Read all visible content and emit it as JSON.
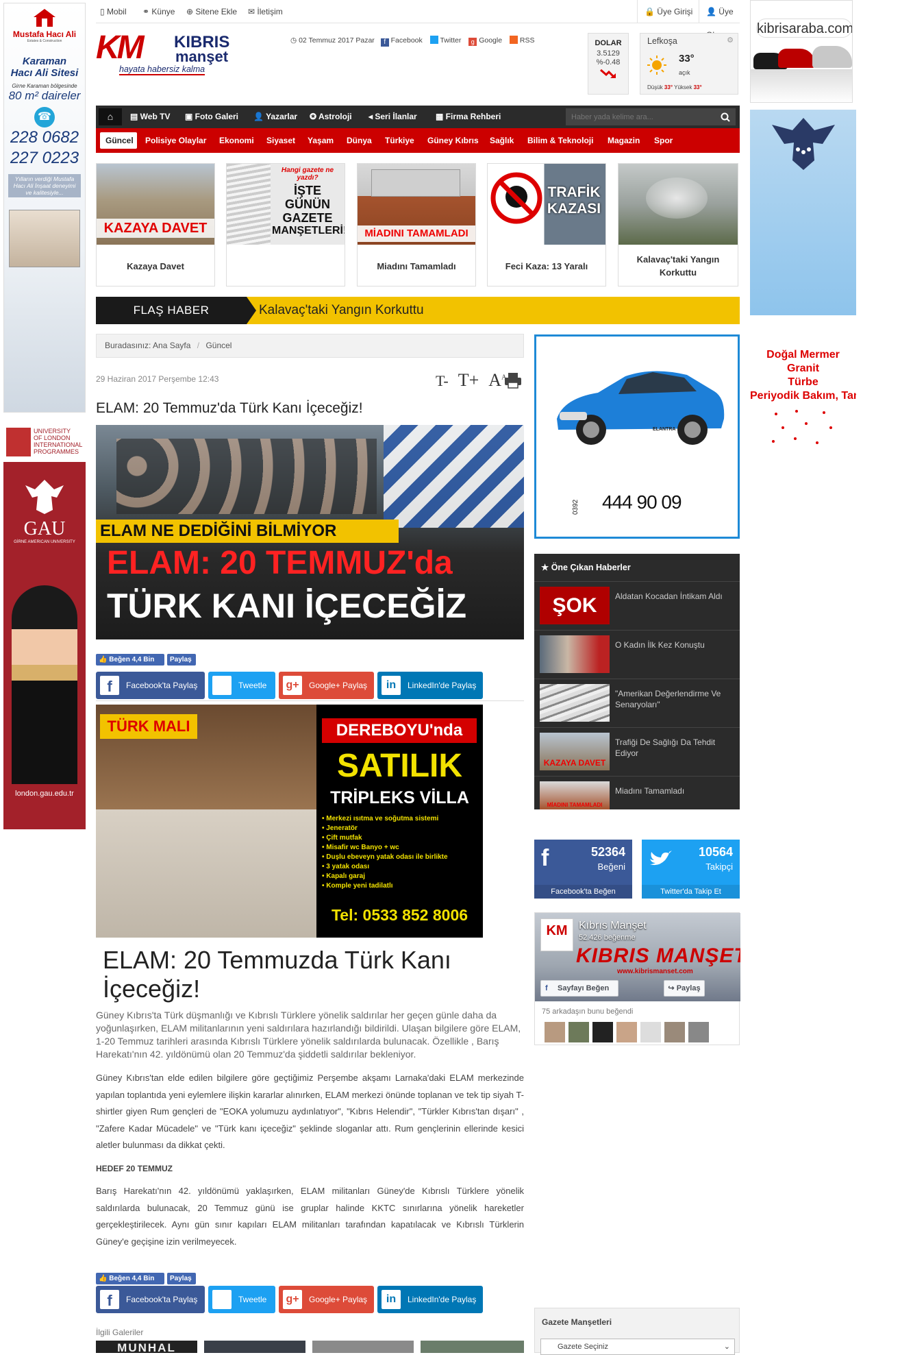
{
  "topbar": {
    "mobil": "Mobil",
    "kunye": "Künye",
    "sitene_ekle": "Sitene Ekle",
    "iletisim": "İletişim",
    "uye_girisi": "Üye Girişi",
    "uye_ol": "Üye Ol"
  },
  "logo": {
    "km": "KM",
    "kibris": "KIBRIS",
    "manset": "manşet",
    "tagline": "hayata habersiz kalma"
  },
  "header": {
    "date": "02 Temmuz 2017 Pazar",
    "facebook": "Facebook",
    "twitter": "Twitter",
    "google": "Google",
    "rss": "RSS"
  },
  "currency": {
    "label": "DOLAR",
    "value": "3.5129",
    "change": "%-0.48"
  },
  "weather": {
    "city": "Lefkoşa",
    "temp": "33°",
    "desc": "açık",
    "low_label": "Düşük",
    "low": "33°",
    "high_label": "Yüksek",
    "high": "33°"
  },
  "nav": {
    "items": [
      "Web TV",
      "Foto Galeri",
      "Yazarlar",
      "Astroloji",
      "Seri İlanlar",
      "Firma Rehberi"
    ],
    "search_placeholder": "Haber yada kelime ara..."
  },
  "categories": [
    "Güncel",
    "Polisiye Olaylar",
    "Ekonomi",
    "Siyaset",
    "Yaşam",
    "Dünya",
    "Türkiye",
    "Güney Kıbrıs",
    "Sağlık",
    "Bilim & Teknoloji",
    "Magazin",
    "Spor"
  ],
  "cards": [
    {
      "overlay": "KAZAYA DAVET",
      "caption": "Kazaya Davet"
    },
    {
      "overlay_line1": "Hangi gazete ne yazdı?",
      "overlay_line2": "İŞTE GÜNÜN",
      "overlay_line3": "GAZETE",
      "overlay_line4": "MANŞETLERİ!",
      "caption": ""
    },
    {
      "overlay": "MİADINI TAMAMLADI",
      "caption": "Miadını Tamamladı"
    },
    {
      "overlay": "TRAFİK KAZASI",
      "caption": "Feci Kaza: 13 Yaralı"
    },
    {
      "caption": "Kalavaç'taki Yangın Korkuttu"
    }
  ],
  "flash": {
    "label": "FLAŞ HABER",
    "headline": "Kalavaç'taki Yangın Korkuttu"
  },
  "breadcrumb": {
    "prefix": "Buradasınız:",
    "home": "Ana Sayfa",
    "current": "Güncel"
  },
  "article": {
    "date": "29 Haziran 2017 Perşembe 12:43",
    "title": "ELAM: 20 Temmuz'da Türk Kanı İçeceğiz!",
    "image_banner1": "ELAM NE DEDİĞİNİ BİLMİYOR",
    "image_banner2": "ELAM: 20 TEMMUZ'da",
    "image_banner3": "TÜRK KANI İÇECEĞİZ",
    "like_label": "Beğen",
    "like_count": "4,4 Bin",
    "share_label": "Paylaş",
    "fb_share": "Facebook'ta Paylaş",
    "tw_share": "Tweetle",
    "gp_share": "Google+ Paylaş",
    "li_share": "LinkedIn'de Paylaş",
    "heading": "ELAM: 20 Temmuzda Türk Kanı İçeceğiz!",
    "lead": "Güney Kıbrıs'ta Türk düşmanlığı ve Kıbrıslı Türklere yönelik saldırılar her geçen günle daha da yoğunlaşırken, ELAM militanlarının yeni saldırılara hazırlandığı bildirildi. Ulaşan bilgilere göre ELAM, 1-20 Temmuz tarihleri arasında Kıbrıslı Türklere yönelik saldırılarda bulunacak. Özellikle , Barış Harekatı'nın 42. yıldönümü olan 20 Temmuz'da şiddetli saldırılar bekleniyor.",
    "p1": "Güney Kıbrıs'tan elde edilen bilgilere göre geçtiğimiz Perşembe akşamı Larnaka'daki ELAM merkezinde yapılan toplantıda yeni eylemlere ilişkin kararlar alınırken, ELAM merkezi önünde toplanan ve tek tip siyah T-shirtler giyen Rum gençleri de \"EOKA yolumuzu aydınlatıyor\", \"Kıbrıs Helendir\", \"Türkler Kıbrıs'tan dışarı\" , \"Zafere Kadar Mücadele\" ve \"Türk kanı içeceğiz\" şeklinde sloganlar attı. Rum gençlerinin ellerinde kesici aletler bulunması da dikkat çekti.",
    "subhead": "HEDEF 20 TEMMUZ",
    "p2": "Barış Harekatı'nın 42. yıldönümü yaklaşırken, ELAM militanları Güney'de Kıbrıslı Türklere yönelik saldırılarda bulunacak, 20 Temmuz günü ise gruplar halinde KKTC sınırlarına yönelik hareketler gerçekleştirilecek. Aynı gün sınır kapıları ELAM militanları tarafından kapatılacak ve Kıbrıslı Türklerin Güney'e geçişine izin verilmeyecek.",
    "related_galleries": "İlgili Galeriler",
    "gallery_thumb1": "MUNHAL"
  },
  "inline_ad": {
    "turk_mali": "TÜRK MALI",
    "line1": "DEREBOYU'nda",
    "line2": "SATILIK",
    "line3": "TRİPLEKS VİLLA",
    "features": [
      "Merkezi ısıtma ve soğutma sistemi",
      "Jeneratör",
      "Çift mutfak",
      "Misafir wc Banyo + wc",
      "Duşlu ebeveyn yatak odası ile birlikte",
      "3 yatak odası",
      "Kapalı garaj",
      "Komple yeni tadilatlı"
    ],
    "phone": "Tel: 0533 852 8006"
  },
  "car_ad": {
    "prefix": "0392",
    "phone": "444 90 09",
    "model": "ELANTRA"
  },
  "trending": {
    "title": "Öne Çıkan Haberler",
    "items": [
      {
        "thumb_text": "ŞOK",
        "title": "Aldatan Kocadan İntikam Aldı"
      },
      {
        "thumb_text": "",
        "title": "O Kadın İlk Kez Konuştu"
      },
      {
        "thumb_text": "",
        "title": "\"Amerikan Değerlendirme Ve Senaryoları\""
      },
      {
        "thumb_text": "KAZAYA DAVET",
        "title": "Trafiği De Sağlığı Da Tehdit Ediyor"
      },
      {
        "thumb_text": "MİADINI TAMAMLADI",
        "title": "Miadını Tamamladı"
      }
    ]
  },
  "social": {
    "fb_count": "52364",
    "fb_label": "Beğeni",
    "fb_cta": "Facebook'ta Beğen",
    "tw_count": "10564",
    "tw_label": "Takipçi",
    "tw_cta": "Twitter'da Takip Et"
  },
  "fb_widget": {
    "name": "Kıbrıs Manşet",
    "likes": "52.426 beğenme",
    "cover_text": "KIBRIS MANŞET",
    "cover_url": "www.kibrismanset.com",
    "page_like": "Sayfayı Beğen",
    "share": "Paylaş",
    "friends": "75 arkadaşın bunu beğendi"
  },
  "gazette": {
    "title": "Gazete Manşetleri",
    "select": "Gazete Seçiniz"
  },
  "left_ad": {
    "brand": "Mustafa Hacı Ali",
    "brand_sub": "Estates & Construction",
    "title1": "Karaman",
    "title2": "Hacı Ali Sitesi",
    "loc": "Girne Karaman bölgesinde",
    "size": "80 m² daireler",
    "phone1": "228 0682",
    "phone2": "227 0223",
    "slogan": "Yılların verdiği Mustafa Hacı Ali İnşaat deneyimi ve kalitesiyle..."
  },
  "left_ad2": {
    "uni1": "UNIVERSITY",
    "uni2": "OF LONDON",
    "uni3": "INTERNATIONAL",
    "uni4": "PROGRAMMES",
    "gau": "GAU",
    "gau_sub": "GİRNE AMERICAN UNIVERSITY",
    "url": "london.gau.edu.tr"
  },
  "right_ad": {
    "site": "kibrisaraba.com",
    "marble1": "Doğal Mermer",
    "marble2": "Granit",
    "marble3": "Türbe",
    "marble4": "Periyodik Bakım, Tamir"
  },
  "colors": {
    "brand_red": "#cc0000",
    "nav_dark": "#2b2b2b",
    "flash_yellow": "#f2c200",
    "facebook": "#3b5998",
    "twitter": "#1da1f2"
  }
}
